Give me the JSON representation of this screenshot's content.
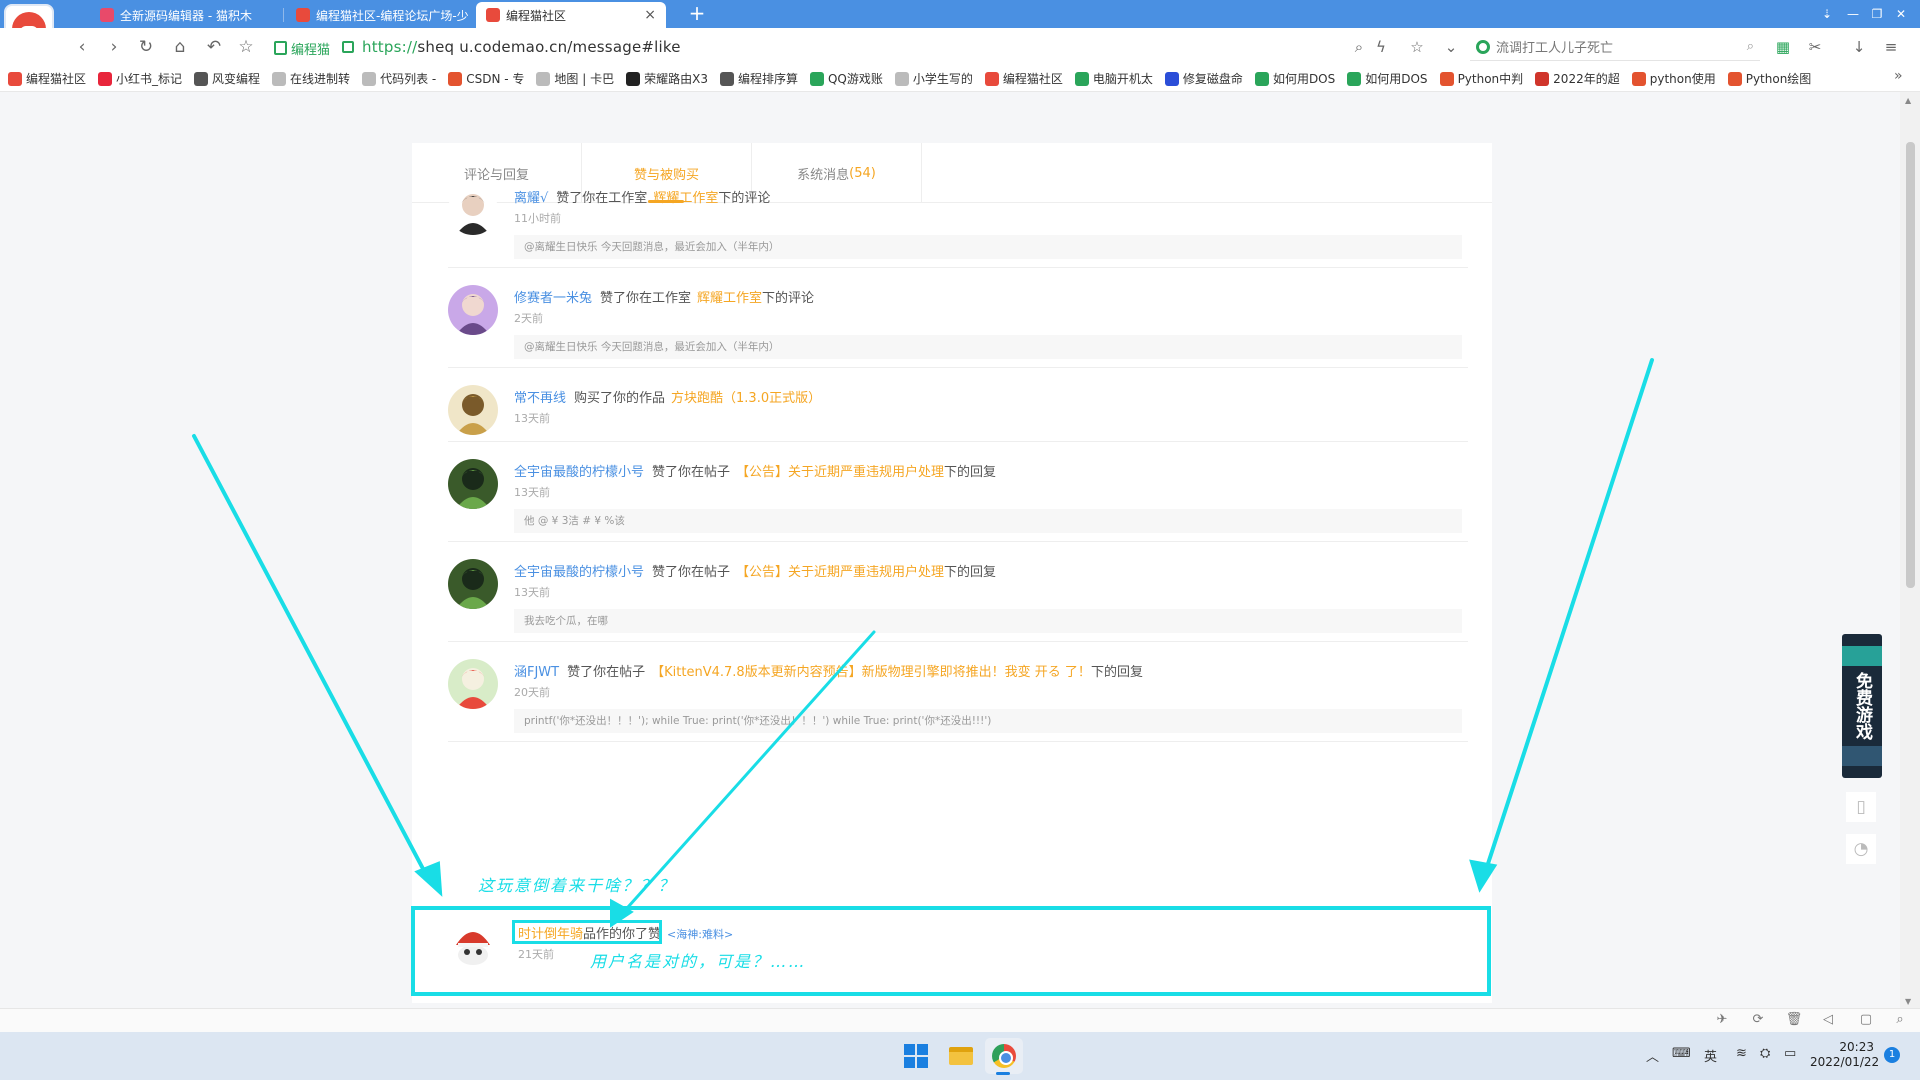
{
  "browser": {
    "tabs": [
      {
        "title": "全新源码编辑器 - 猫积木",
        "icon_color": "#e84a6a"
      },
      {
        "title": "编程猫社区-编程论坛广场-少",
        "icon_color": "#e84a3c"
      },
      {
        "title": "编程猫社区",
        "icon_color": "#e84a3c"
      }
    ],
    "tab_close": "×",
    "new_tab": "+",
    "window_controls": [
      "⇣",
      "—",
      "❐",
      "✕"
    ],
    "nav": {
      "back": "‹",
      "forward": "›",
      "reload": "↻",
      "home": "⌂",
      "undo": "↶",
      "star": "☆"
    },
    "safe_label": "编程猫",
    "url_scheme": "https://",
    "url_rest": "sheq u.codemao.cn/message#like",
    "toolbar_icons": {
      "zoom": "⌕",
      "bolt": "ϟ",
      "bookmark": "☆",
      "dropdown": "⌄",
      "apps": "▦",
      "scissors": "✂",
      "download": "↓",
      "menu": "≡"
    },
    "search_text": "流调打工人儿子死亡",
    "search_icon": "⌕",
    "bookmarks": [
      {
        "label": "编程猫社区",
        "color": "#e84a3c"
      },
      {
        "label": "小红书_标记",
        "color": "#e8253b"
      },
      {
        "label": "风变编程",
        "color": "#555555"
      },
      {
        "label": "在线进制转",
        "color": "#bbbbbb"
      },
      {
        "label": "代码列表 -",
        "color": "#bbbbbb"
      },
      {
        "label": "CSDN - 专",
        "color": "#e3532f"
      },
      {
        "label": "地图 | 卡巴",
        "color": "#bbbbbb"
      },
      {
        "label": "荣耀路由X3",
        "color": "#222222"
      },
      {
        "label": "编程排序算",
        "color": "#555555"
      },
      {
        "label": "QQ游戏账",
        "color": "#2aa55a"
      },
      {
        "label": "小学生写的",
        "color": "#bbbbbb"
      },
      {
        "label": "编程猫社区",
        "color": "#e84a3c"
      },
      {
        "label": "电脑开机太",
        "color": "#2aa55a"
      },
      {
        "label": "修复磁盘命",
        "color": "#2b4ed8"
      },
      {
        "label": "如何用DOS",
        "color": "#2aa55a"
      },
      {
        "label": "如何用DOS",
        "color": "#2aa55a"
      },
      {
        "label": "Python中判",
        "color": "#e3532f"
      },
      {
        "label": "2022年的超",
        "color": "#d0352b"
      },
      {
        "label": "python使用",
        "color": "#e3532f"
      },
      {
        "label": "Python绘图",
        "color": "#e3532f"
      }
    ],
    "bookmarks_more": "»"
  },
  "message_tabs": [
    {
      "label": "评论与回复",
      "count": ""
    },
    {
      "label": "赞与被购买",
      "count": ""
    },
    {
      "label": "系统消息",
      "count": "(54)"
    }
  ],
  "messages": [
    {
      "user": "离耀√",
      "action": "赞了你在工作室",
      "target": "辉耀工作室",
      "suffix": "下的评论",
      "time": "11小时前",
      "quote": "@离耀生日快乐 今天回题消息，最近会加入（半年内）",
      "avatar_colors": [
        "#ffffff",
        "#2a2a2a",
        "#e8d0c0"
      ]
    },
    {
      "user": "修赛者一米兔",
      "action": "赞了你在工作室",
      "target": "辉耀工作室",
      "suffix": "下的评论",
      "time": "2天前",
      "quote": "@离耀生日快乐 今天回题消息，最近会加入（半年内）",
      "avatar_colors": [
        "#c9a8e8",
        "#6a4a8a",
        "#f0d8d0"
      ]
    },
    {
      "user": "常不再线",
      "action": "购买了你的作品",
      "target": "方块跑酷（1.3.0正式版）",
      "suffix": "",
      "time": "13天前",
      "quote": "",
      "avatar_colors": [
        "#f0e6c8",
        "#c9a04a",
        "#7a5a2a"
      ]
    },
    {
      "user": "全宇宙最酸的柠檬小号",
      "action": "赞了你在帖子",
      "target": "【公告】关于近期严重违规用户处理",
      "suffix": "下的回复",
      "time": "13天前",
      "quote": "他 @ ¥ 3洁 # ¥ %该",
      "avatar_colors": [
        "#3a5a2a",
        "#6aa84a",
        "#1a2a1a"
      ]
    },
    {
      "user": "全宇宙最酸的柠檬小号",
      "action": "赞了你在帖子",
      "target": "【公告】关于近期严重违规用户处理",
      "suffix": "下的回复",
      "time": "13天前",
      "quote": "我去吃个瓜，在哪",
      "avatar_colors": [
        "#3a5a2a",
        "#6aa84a",
        "#1a2a1a"
      ]
    },
    {
      "user": "涵FJWT",
      "action": "赞了你在帖子",
      "target": "【KittenV4.7.8版本更新内容预告】新版物理引擎即将推出！我变 开る 了！",
      "suffix": "下的回复",
      "time": "20天前",
      "quote": "printf('你*还没出！！！');   while True: print('你*还没出！！！') while True: print('你*还没出!!!')",
      "avatar_colors": [
        "#d8ecc8",
        "#e84a3c",
        "#f5f0e0"
      ]
    }
  ],
  "last_message": {
    "user": "时计倒年骑",
    "middle": "品作的你了赞",
    "target": "<海神:难料>",
    "time": "21天前",
    "avatar_colors": [
      "#ffffff",
      "#d83a2c",
      "#333333"
    ]
  },
  "annotations": {
    "note1": "这玩意倒着来干啥？？？",
    "note2": "用户名是对的，可是？……",
    "color": "#19dde6"
  },
  "side": {
    "ad_text": "免费游戏",
    "phone_icon": "▯",
    "bell_icon": "◔"
  },
  "status_icons": [
    "✈",
    "⟳",
    "🗑",
    "◁",
    "▢",
    "⌕"
  ],
  "taskbar": {
    "tray": {
      "chevron": "︿",
      "keyboard": "⌨",
      "ime": "英",
      "wifi": "≋",
      "net": "⛭",
      "battery": "▭"
    },
    "time": "20:23",
    "date": "2022/01/22",
    "notifications": "1"
  }
}
